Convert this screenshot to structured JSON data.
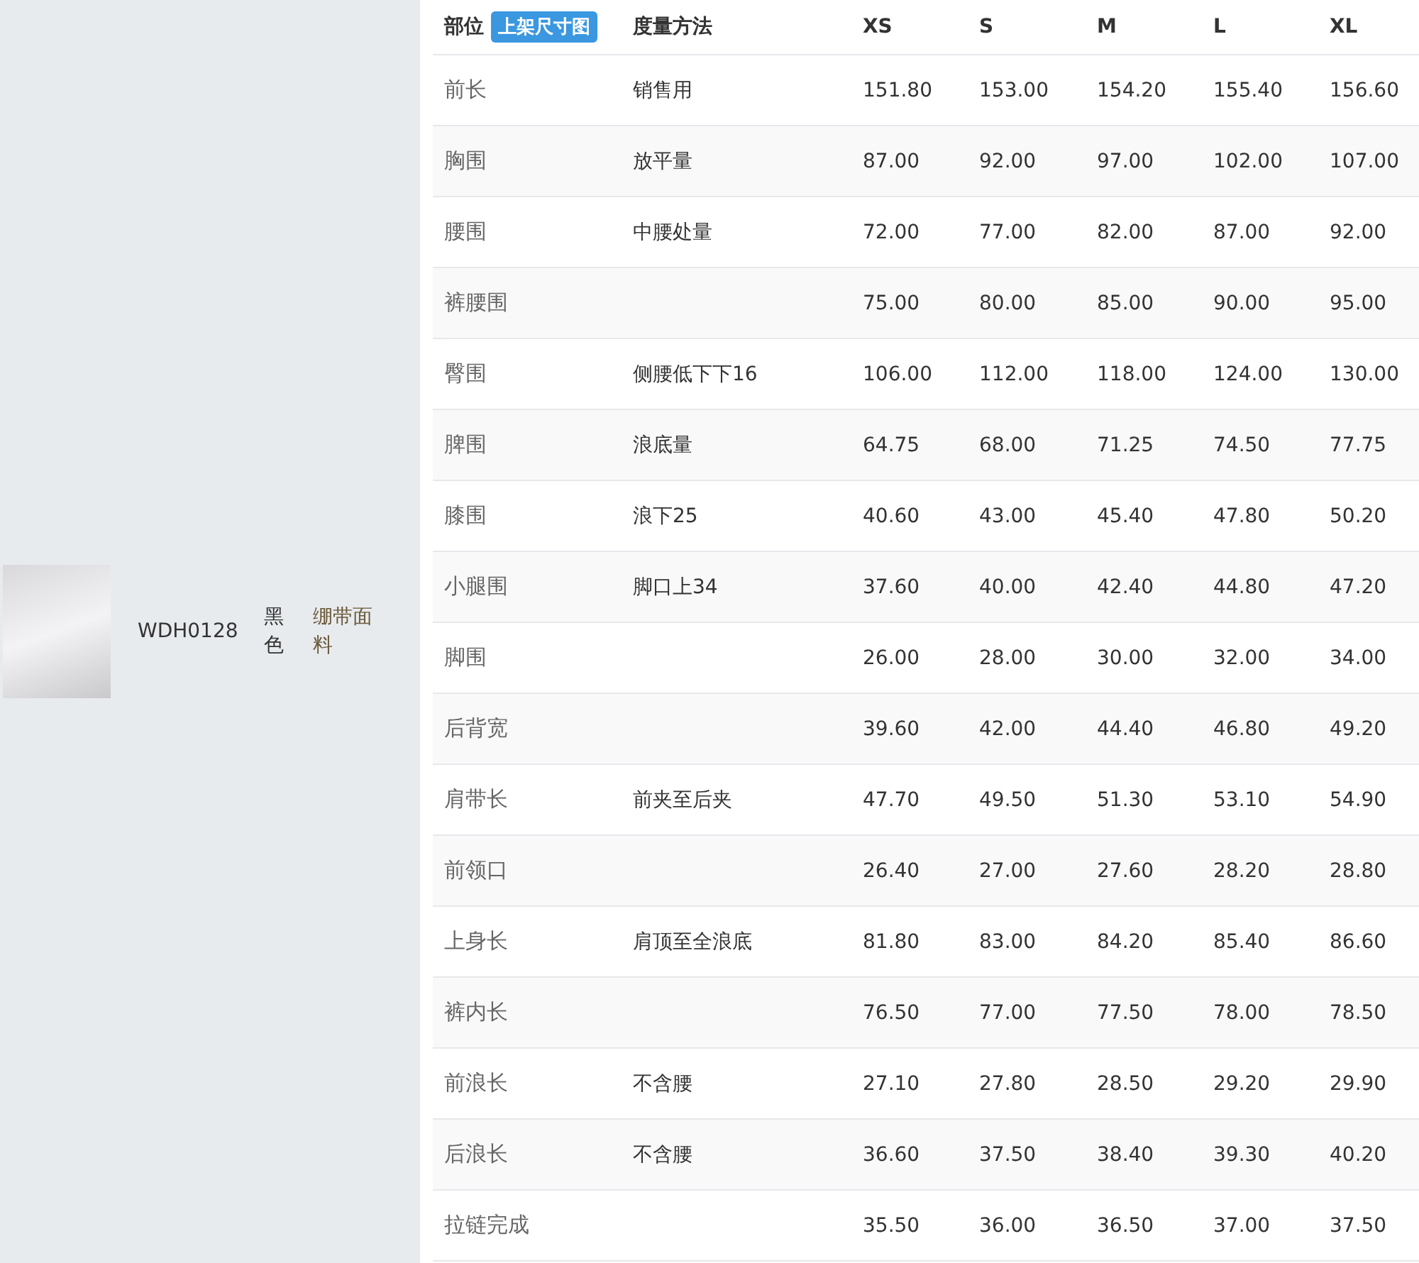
{
  "product": {
    "code": "WDH0128",
    "color_name": "黑色",
    "material": "绷带面料"
  },
  "table": {
    "columns": [
      "部位",
      "度量方法",
      "XS",
      "S",
      "M",
      "L",
      "XL"
    ],
    "badge": "上架尺寸图",
    "rows": [
      {
        "part": "前长",
        "method": "销售用",
        "values": [
          "151.80",
          "153.00",
          "154.20",
          "155.40",
          "156.60"
        ]
      },
      {
        "part": "胸围",
        "method": "放平量",
        "values": [
          "87.00",
          "92.00",
          "97.00",
          "102.00",
          "107.00"
        ]
      },
      {
        "part": "腰围",
        "method": "中腰处量",
        "values": [
          "72.00",
          "77.00",
          "82.00",
          "87.00",
          "92.00"
        ]
      },
      {
        "part": "裤腰围",
        "method": "",
        "values": [
          "75.00",
          "80.00",
          "85.00",
          "90.00",
          "95.00"
        ]
      },
      {
        "part": "臀围",
        "method": "侧腰低下下16",
        "values": [
          "106.00",
          "112.00",
          "118.00",
          "124.00",
          "130.00"
        ]
      },
      {
        "part": "脾围",
        "method": "浪底量",
        "values": [
          "64.75",
          "68.00",
          "71.25",
          "74.50",
          "77.75"
        ]
      },
      {
        "part": "膝围",
        "method": "浪下25",
        "values": [
          "40.60",
          "43.00",
          "45.40",
          "47.80",
          "50.20"
        ]
      },
      {
        "part": "小腿围",
        "method": "脚口上34",
        "values": [
          "37.60",
          "40.00",
          "42.40",
          "44.80",
          "47.20"
        ]
      },
      {
        "part": "脚围",
        "method": "",
        "values": [
          "26.00",
          "28.00",
          "30.00",
          "32.00",
          "34.00"
        ]
      },
      {
        "part": "后背宽",
        "method": "",
        "values": [
          "39.60",
          "42.00",
          "44.40",
          "46.80",
          "49.20"
        ]
      },
      {
        "part": "肩带长",
        "method": "前夹至后夹",
        "values": [
          "47.70",
          "49.50",
          "51.30",
          "53.10",
          "54.90"
        ]
      },
      {
        "part": "前领口",
        "method": "",
        "values": [
          "26.40",
          "27.00",
          "27.60",
          "28.20",
          "28.80"
        ]
      },
      {
        "part": "上身长",
        "method": "肩顶至全浪底",
        "values": [
          "81.80",
          "83.00",
          "84.20",
          "85.40",
          "86.60"
        ]
      },
      {
        "part": "裤内长",
        "method": "",
        "values": [
          "76.50",
          "77.00",
          "77.50",
          "78.00",
          "78.50"
        ]
      },
      {
        "part": "前浪长",
        "method": "不含腰",
        "values": [
          "27.10",
          "27.80",
          "28.50",
          "29.20",
          "29.90"
        ]
      },
      {
        "part": "后浪长",
        "method": "不含腰",
        "values": [
          "36.60",
          "37.50",
          "38.40",
          "39.30",
          "40.20"
        ]
      },
      {
        "part": "拉链完成",
        "method": "",
        "values": [
          "35.50",
          "36.00",
          "36.50",
          "37.00",
          "37.50"
        ]
      }
    ]
  }
}
